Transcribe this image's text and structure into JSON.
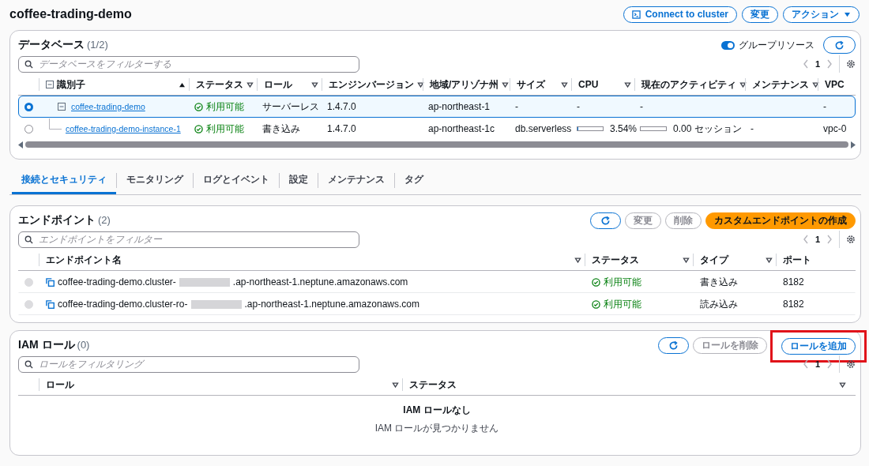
{
  "page": {
    "title": "coffee-trading-demo",
    "actions": [
      {
        "kind": "connect",
        "label": "Connect to cluster"
      },
      {
        "kind": "plain",
        "label": "変更"
      },
      {
        "kind": "dropdown",
        "label": "アクション"
      }
    ]
  },
  "databases": {
    "title": "データベース",
    "count": "(1/2)",
    "group_resources": {
      "label": "グループリソース",
      "on": true
    },
    "search": {
      "placeholder": "データベースをフィルターする"
    },
    "pagination": {
      "page": "1"
    },
    "columns": [
      {
        "label": "識別子",
        "kind": "sorted"
      },
      {
        "label": "ステータス",
        "kind": "filterable"
      },
      {
        "label": "ロール",
        "kind": "filterable"
      },
      {
        "label": "エンジンバージョン",
        "kind": "filterable"
      },
      {
        "label": "地域/アリゾナ州",
        "kind": "filterable"
      },
      {
        "label": "サイズ",
        "kind": "filterable"
      },
      {
        "label": "CPU",
        "kind": "filterable"
      },
      {
        "label": "現在のアクティビティ",
        "kind": "filterable"
      },
      {
        "label": "メンテナンス",
        "kind": "filterable"
      },
      {
        "label": "VPC",
        "kind": "plain"
      }
    ],
    "rows": [
      {
        "selected": true,
        "expanded": true,
        "cells": [
          {
            "kind": "link",
            "text": "coffee-trading-demo"
          },
          {
            "kind": "status",
            "text": "利用可能"
          },
          {
            "kind": "text",
            "text": "サーバーレス"
          },
          {
            "kind": "text",
            "text": "1.4.7.0"
          },
          {
            "kind": "text",
            "text": "ap-northeast-1"
          },
          {
            "kind": "text",
            "text": "-"
          },
          {
            "kind": "text",
            "text": "-"
          },
          {
            "kind": "text",
            "text": "-"
          },
          {
            "kind": "empty"
          },
          {
            "kind": "text",
            "text": "-"
          }
        ],
        "children": [
          {
            "selected": false,
            "cells": [
              {
                "kind": "link",
                "text": "coffee-trading-demo-instance-1"
              },
              {
                "kind": "status",
                "text": "利用可能"
              },
              {
                "kind": "text",
                "text": "書き込み"
              },
              {
                "kind": "text",
                "text": "1.4.7.0"
              },
              {
                "kind": "text",
                "text": "ap-northeast-1c"
              },
              {
                "kind": "text",
                "text": "db.serverless"
              },
              {
                "kind": "meter",
                "level": 0.0354,
                "text": "3.54%"
              },
              {
                "kind": "meter",
                "text": "0.00 セッション"
              },
              {
                "kind": "text",
                "text": "-"
              },
              {
                "kind": "text",
                "text": "vpc-0"
              }
            ]
          }
        ]
      }
    ]
  },
  "tabs": [
    {
      "label": "接続とセキュリティ",
      "selected": true
    },
    {
      "label": "モニタリング",
      "selected": false
    },
    {
      "label": "ログとイベント",
      "selected": false
    },
    {
      "label": "設定",
      "selected": false
    },
    {
      "label": "メンテナンス",
      "selected": false
    },
    {
      "label": "タグ",
      "selected": false
    }
  ],
  "endpoints": {
    "title": "エンドポイント",
    "count": "(2)",
    "buttons": [
      {
        "kind": "refresh",
        "disabled": false
      },
      {
        "kind": "text",
        "label": "変更",
        "disabled": true
      },
      {
        "kind": "text",
        "label": "削除",
        "disabled": true
      },
      {
        "kind": "primary",
        "label": "カスタムエンドポイントの作成",
        "disabled": false
      }
    ],
    "search": {
      "placeholder": "エンドポイントをフィルター"
    },
    "pagination": {
      "page": "1"
    },
    "columns": [
      {
        "label": "エンドポイント名",
        "kind": "filterable"
      },
      {
        "label": "ステータス",
        "kind": "filterable"
      },
      {
        "label": "タイプ",
        "kind": "filterable"
      },
      {
        "label": "ポート",
        "kind": "plain"
      }
    ],
    "rows": [
      {
        "disabled": true,
        "name_start": "coffee-trading-demo.cluster-",
        "redacted": true,
        "name_end": ".ap-northeast-1.neptune.amazonaws.com",
        "status": "利用可能",
        "type": "書き込み",
        "port": "8182"
      },
      {
        "disabled": true,
        "name_start": "coffee-trading-demo.cluster-ro-",
        "redacted": true,
        "name_end": ".ap-northeast-1.neptune.amazonaws.com",
        "status": "利用可能",
        "type": "読み込み",
        "port": "8182"
      }
    ]
  },
  "iam": {
    "title": "IAM ロール",
    "count": "(0)",
    "buttons": [
      {
        "kind": "refresh",
        "disabled": false
      },
      {
        "kind": "text",
        "label": "ロールを削除",
        "disabled": true
      },
      {
        "kind": "text",
        "label": "ロールを追加",
        "disabled": false,
        "highlighted": true
      }
    ],
    "search": {
      "placeholder": "ロールをフィルタリング"
    },
    "pagination": {
      "page": "1"
    },
    "columns": [
      {
        "label": "ロール",
        "kind": "filterable"
      },
      {
        "label": "ステータス",
        "kind": "filterable"
      }
    ],
    "empty": {
      "title": "IAM ロールなし",
      "message": "IAM ロールが見つかりません"
    }
  }
}
